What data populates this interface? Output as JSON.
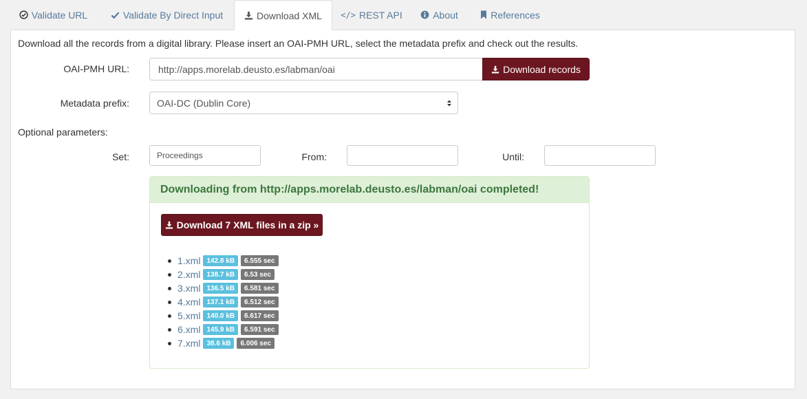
{
  "tabs": [
    {
      "label": "Validate URL",
      "icon": "check-circle-icon"
    },
    {
      "label": "Validate By Direct Input",
      "icon": "check-icon"
    },
    {
      "label": "Download XML",
      "icon": "download-icon",
      "active": true
    },
    {
      "label": "REST API",
      "icon": "code-icon"
    },
    {
      "label": "About",
      "icon": "info-circle-icon"
    },
    {
      "label": "References",
      "icon": "bookmark-icon"
    }
  ],
  "panel": {
    "intro": "Download all the records from a digital library. Please insert an OAI-PMH URL, select the metadata prefix and check out the results.",
    "url_label": "OAI-PMH URL:",
    "url_value": "http://apps.morelab.deusto.es/labman/oai",
    "download_records_label": "Download records",
    "prefix_label": "Metadata prefix:",
    "prefix_value": "OAI-DC (Dublin Core)",
    "optional_label": "Optional parameters:",
    "set_label": "Set:",
    "set_value": "Proceedings",
    "from_label": "From:",
    "from_value": "",
    "until_label": "Until:",
    "until_value": ""
  },
  "result": {
    "message": "Downloading from http://apps.morelab.deusto.es/labman/oai completed!",
    "zip_button": "Download 7 XML files in a zip »",
    "files": [
      {
        "name": "1.xml",
        "size": "142.8 kB",
        "time": "6.555 sec"
      },
      {
        "name": "2.xml",
        "size": "138.7 kB",
        "time": "6.53 sec"
      },
      {
        "name": "3.xml",
        "size": "136.5 kB",
        "time": "6.581 sec"
      },
      {
        "name": "4.xml",
        "size": "137.1 kB",
        "time": "6.512 sec"
      },
      {
        "name": "5.xml",
        "size": "140.0 kB",
        "time": "6.617 sec"
      },
      {
        "name": "6.xml",
        "size": "145.9 kB",
        "time": "6.591 sec"
      },
      {
        "name": "7.xml",
        "size": "38.6 kB",
        "time": "6.006 sec"
      }
    ]
  },
  "colors": {
    "link": "#587a9b",
    "primary_button": "#6b1620",
    "success_bg": "#dff0d8",
    "success_text": "#3c763d",
    "size_badge": "#5bc0de",
    "time_badge": "#777777"
  }
}
